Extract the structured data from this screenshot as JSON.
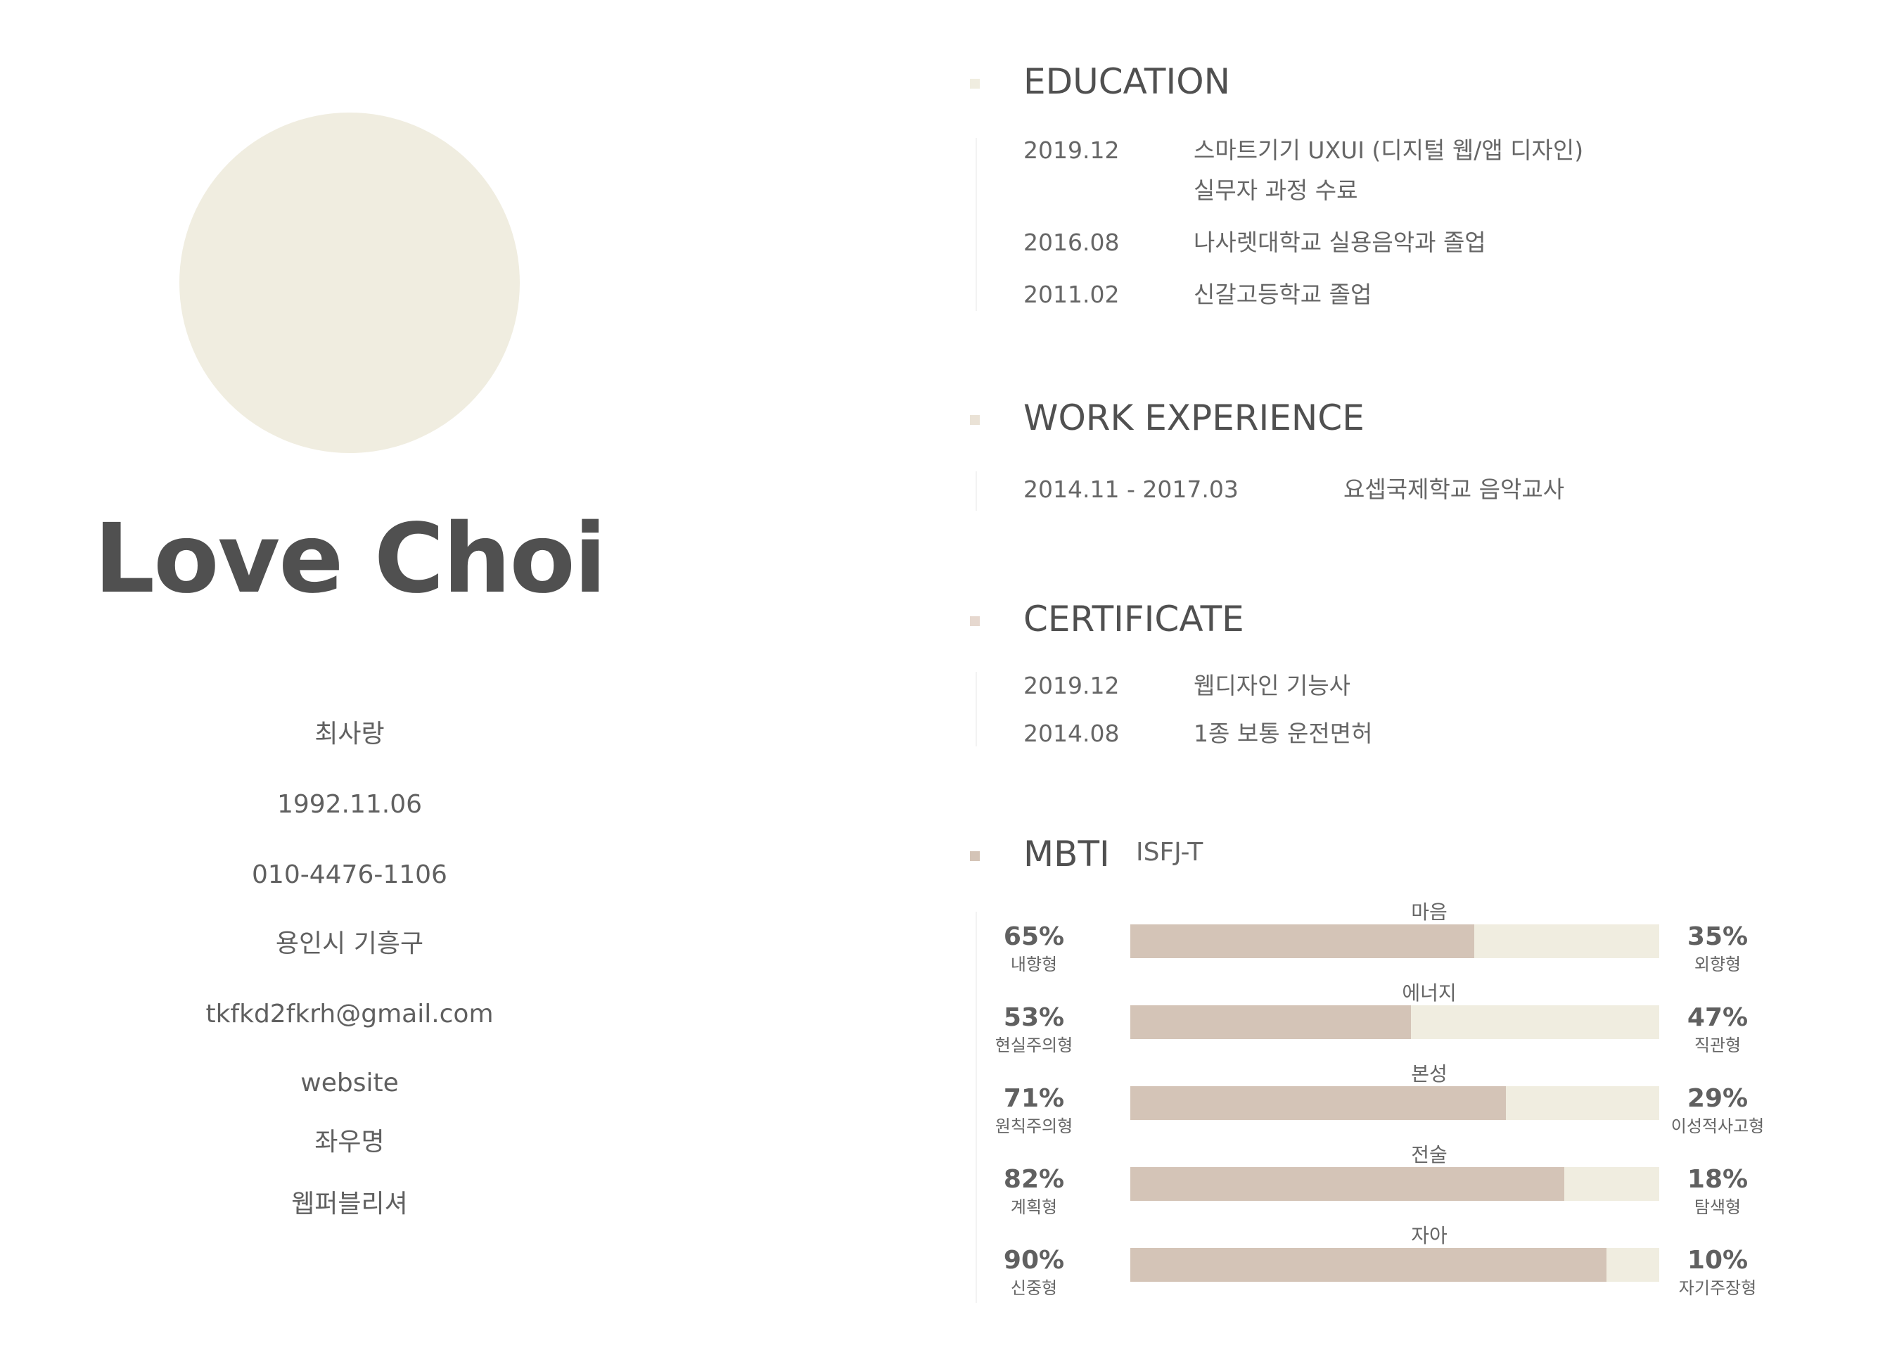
{
  "profile": {
    "name": "Love Choi",
    "korean_name": "최사랑",
    "birthdate": "1992.11.06",
    "phone": "010-4476-1106",
    "address": "용인시 기흥구",
    "email": "tkfkd2fkrh@gmail.com",
    "website": "website",
    "motto_label": "좌우명",
    "role": "웹퍼블리셔"
  },
  "education": {
    "title": "EDUCATION",
    "items": [
      {
        "date": "2019.12",
        "line1": "스마트기기 UXUI (디지털 웹/앱 디자인)",
        "line2": "실무자 과정 수료"
      },
      {
        "date": "2016.08",
        "line1": "나사렛대학교 실용음악과 졸업"
      },
      {
        "date": "2011.02",
        "line1": "신갈고등학교 졸업"
      }
    ]
  },
  "work": {
    "title": "WORK EXPERIENCE",
    "items": [
      {
        "period": "2014.11 - 2017.03",
        "desc": "요셉국제학교 음악교사"
      }
    ]
  },
  "certificate": {
    "title": "CERTIFICATE",
    "items": [
      {
        "date": "2019.12",
        "name": "웹디자인 기능사"
      },
      {
        "date": "2014.08",
        "name": "1종 보통 운전면허"
      }
    ]
  },
  "mbti": {
    "title": "MBTI",
    "type": "ISFJ-T",
    "bars": [
      {
        "label": "마음",
        "left_pct": "65%",
        "left_type": "내향형",
        "right_pct": "35%",
        "right_type": "외향형",
        "fill": 0.65
      },
      {
        "label": "에너지",
        "left_pct": "53%",
        "left_type": "현실주의형",
        "right_pct": "47%",
        "right_type": "직관형",
        "fill": 0.53
      },
      {
        "label": "본성",
        "left_pct": "71%",
        "left_type": "원칙주의형",
        "right_pct": "29%",
        "right_type": "이성적사고형",
        "fill": 0.71
      },
      {
        "label": "전술",
        "left_pct": "82%",
        "left_type": "계획형",
        "right_pct": "18%",
        "right_type": "탐색형",
        "fill": 0.82
      },
      {
        "label": "자아",
        "left_pct": "90%",
        "left_type": "신중형",
        "right_pct": "10%",
        "right_type": "자기주장형",
        "fill": 0.9
      }
    ]
  },
  "colors": {
    "photo_placeholder": "#f0ede0",
    "bar_fill": "#d4c4b7",
    "bar_track": "#f0ede0",
    "marker_education": "#f0ede0",
    "marker_work": "#eae2d6",
    "marker_certificate": "#e6d8cf",
    "marker_mbti": "#d4c4b7",
    "text_dark": "#505050"
  }
}
